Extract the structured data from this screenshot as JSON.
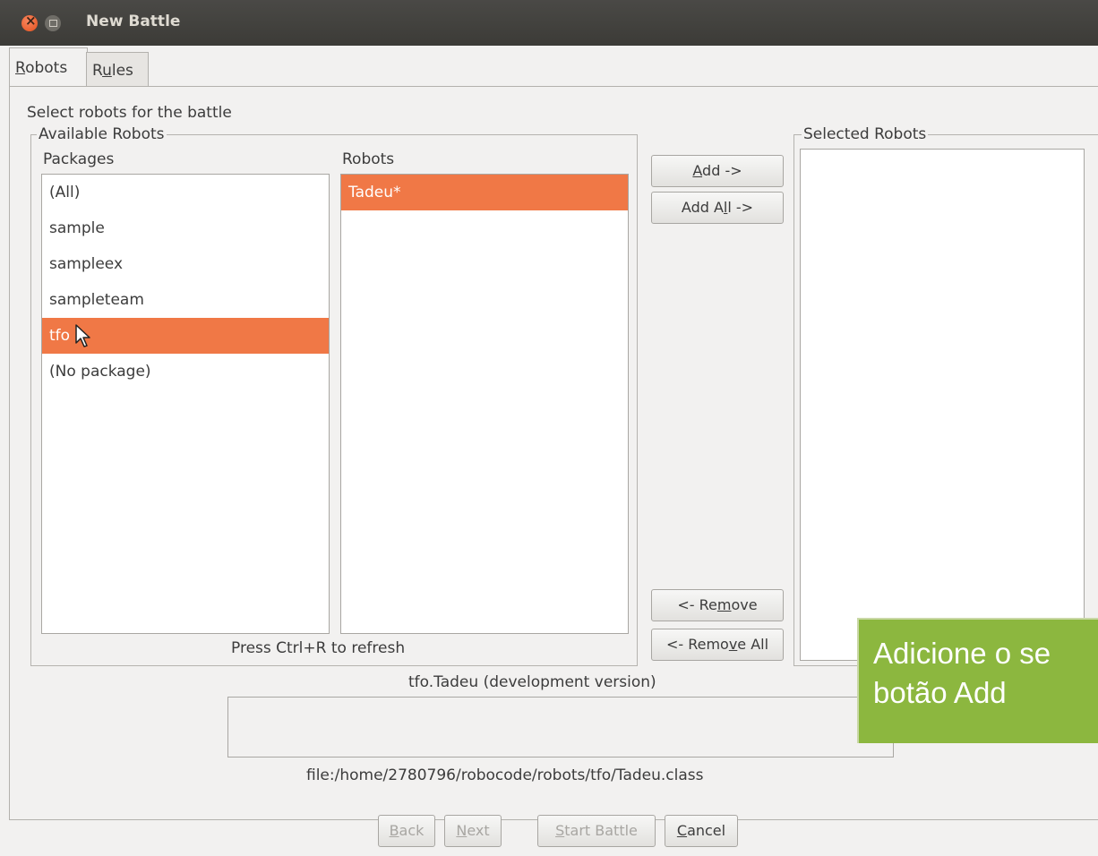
{
  "window": {
    "title": "New Battle"
  },
  "tabs": [
    {
      "prefix": "",
      "mnemonic": "R",
      "suffix": "obots"
    },
    {
      "prefix": "R",
      "mnemonic": "u",
      "suffix": "les"
    }
  ],
  "main": {
    "heading": "Select robots for the battle",
    "available_title": "Available Robots",
    "packages_header": "Packages",
    "robots_header": "Robots",
    "packages": [
      "(All)",
      "sample",
      "sampleex",
      "sampleteam",
      "tfo",
      "(No package)"
    ],
    "selected_package": "tfo",
    "robots": [
      "Tadeu*"
    ],
    "refresh_hint": "Press Ctrl+R to refresh",
    "selected_title": "Selected Robots",
    "robot_name": "tfo.Tadeu (development version)",
    "robot_path": "file:/home/2780796/robocode/robots/tfo/Tadeu.class"
  },
  "buttons": {
    "add": {
      "prefix": "",
      "mnemonic": "A",
      "suffix": "dd ->"
    },
    "add_all": {
      "prefix": "Add A",
      "mnemonic": "l",
      "suffix": "l ->"
    },
    "remove": {
      "prefix": "<- Re",
      "mnemonic": "m",
      "suffix": "ove"
    },
    "remove_all": {
      "prefix": "<- Remo",
      "mnemonic": "v",
      "suffix": "e All"
    },
    "back": {
      "prefix": "",
      "mnemonic": "B",
      "suffix": "ack"
    },
    "next": {
      "prefix": "",
      "mnemonic": "N",
      "suffix": "ext"
    },
    "start": {
      "prefix": "",
      "mnemonic": "S",
      "suffix": "tart Battle"
    },
    "cancel": {
      "prefix": "",
      "mnemonic": "C",
      "suffix": "ancel"
    }
  },
  "callout": {
    "line1": "Adicione o se",
    "line2": "botão Add"
  },
  "colors": {
    "selection": "#f07846",
    "callout": "#8cb73f",
    "titlebar": "#3c3b37"
  }
}
